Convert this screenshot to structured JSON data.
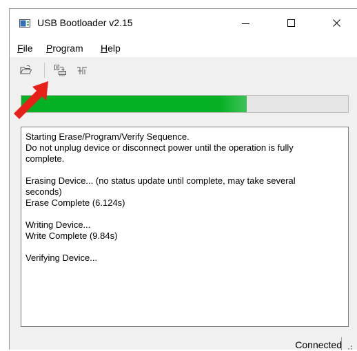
{
  "window": {
    "title": "USB Bootloader v2.15",
    "icon": "app-window-icon"
  },
  "menu": {
    "items": [
      {
        "label": "File",
        "mnemonic": "F",
        "rest": "ile"
      },
      {
        "label": "Program",
        "mnemonic": "P",
        "rest": "rogram"
      },
      {
        "label": "Help",
        "mnemonic": "H",
        "rest": "elp"
      }
    ]
  },
  "toolbar": {
    "buttons": [
      "open-folder-icon",
      "program-device-icon",
      "reset-device-icon"
    ]
  },
  "progress": {
    "fraction": 0.69,
    "color": "#06b025"
  },
  "log": {
    "lines": [
      "Starting Erase/Program/Verify Sequence.",
      "Do not unplug device or disconnect power until the operation is fully",
      "complete.",
      "",
      "Erasing Device... (no status update until complete, may take several",
      "seconds)",
      "Erase Complete (6.124s)",
      "",
      "Writing Device...",
      "Write Complete (9.84s)",
      "",
      "Verifying Device..."
    ]
  },
  "statusbar": {
    "status": "Connected"
  },
  "annotation": {
    "arrow_color": "#e8201a"
  }
}
